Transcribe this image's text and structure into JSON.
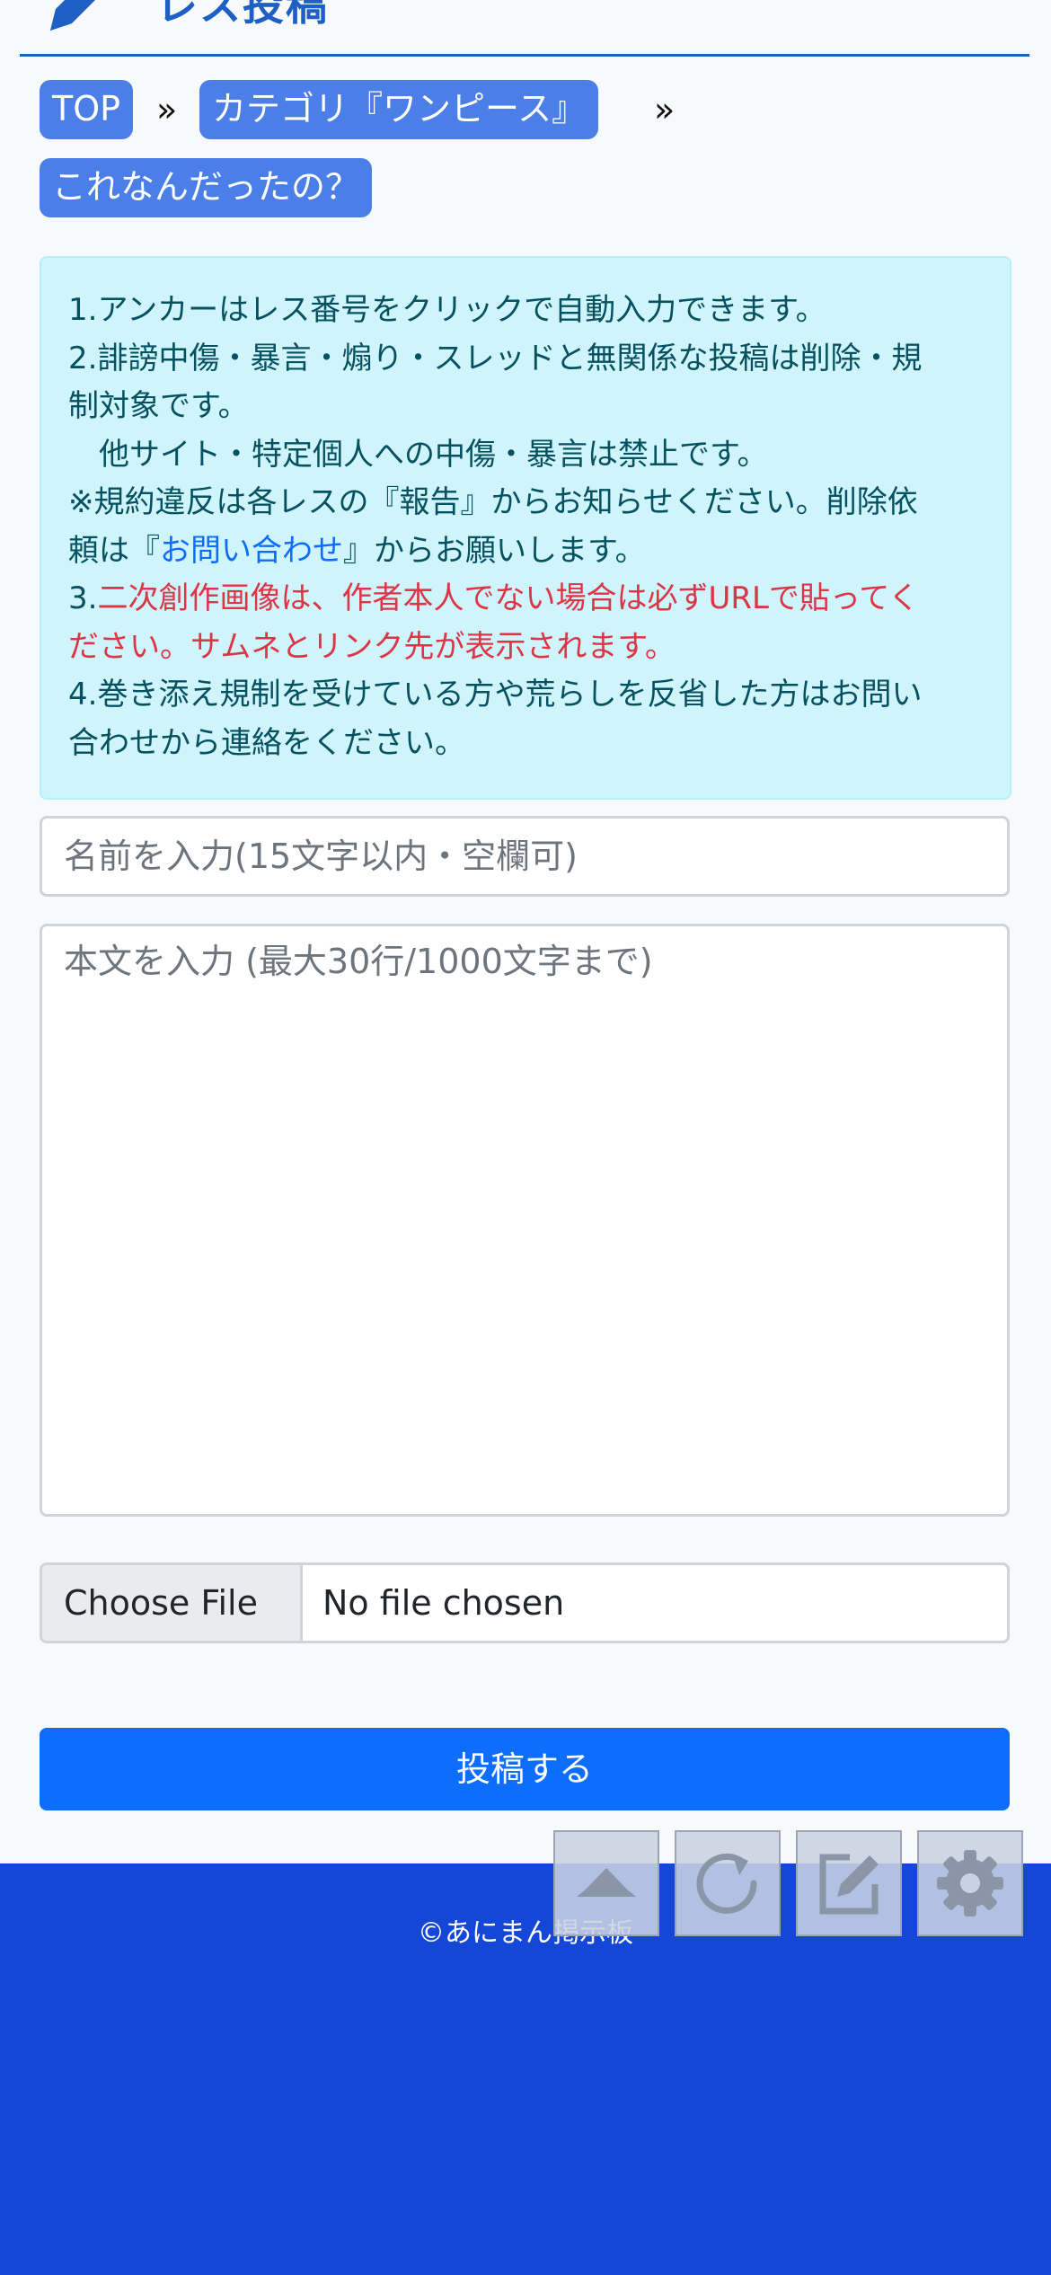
{
  "section_title": "レス投稿",
  "breadcrumb": {
    "top": "TOP",
    "sep1": "»",
    "category": "カテゴリ『ワンピース』",
    "sep2": "»",
    "thread": "これなんだったの？"
  },
  "notice": {
    "line1": "1.アンカーはレス番号をクリックで自動入力できます。",
    "line2": "2.誹謗中傷・暴言・煽り・スレッドと無関係な投稿は削除・規",
    "line3": "制対象です。",
    "line4": "　他サイト・特定個人への中傷・暴言は禁止です。",
    "line5": "※規約違反は各レスの『報告』からお知らせください。削除依",
    "line6_pre": "頼は『",
    "line6_link": "お問い合わせ",
    "line6_post": "』からお願いします。",
    "line7_num": "3.",
    "line7_red": "二次創作画像は、作者本人でない場合は必ずURLで貼ってく",
    "line8_red": "ださい。サムネとリンク先が表示されます。",
    "line9": "4.巻き添え規制を受けている方や荒らしを反省した方はお問い",
    "line10": "合わせから連絡をください。"
  },
  "form": {
    "name_placeholder": "名前を入力(15文字以内・空欄可)",
    "body_placeholder": "本文を入力 (最大30行/1000文字まで)",
    "choose_file_label": "Choose File",
    "file_status": "No file chosen",
    "submit_label": "投稿する"
  },
  "footer": {
    "copyright": "©あにまん掲示板"
  },
  "floating_buttons": [
    "scroll-top",
    "reload",
    "compose",
    "settings"
  ],
  "colors": {
    "accent": "#1d5fc4",
    "footer_bg": "#1446d8",
    "primary_button": "#0d6efd",
    "breadcrumb_bg": "#4b7fe7",
    "notice_bg": "#cff4fc",
    "notice_text": "#055160",
    "notice_red": "#dc3545"
  }
}
